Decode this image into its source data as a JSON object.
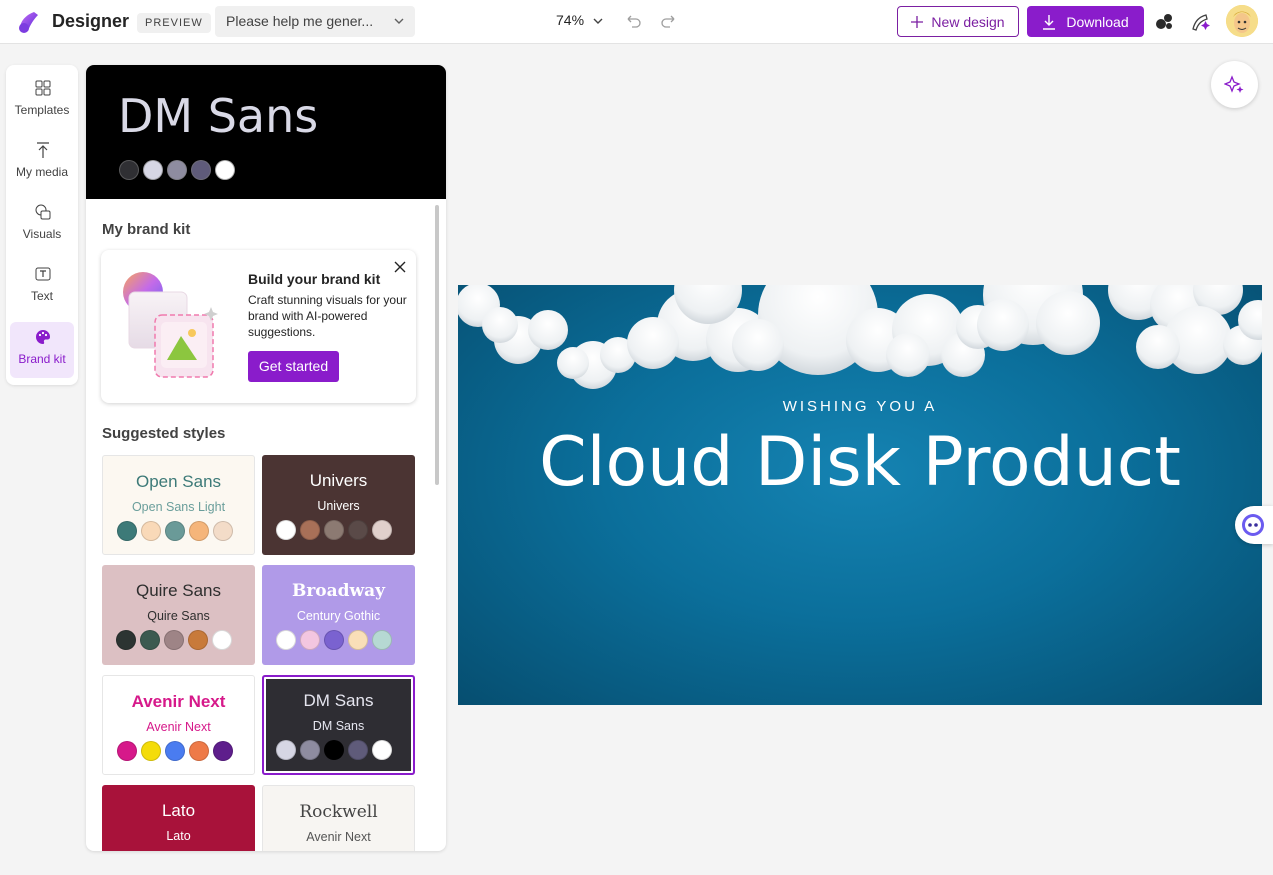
{
  "app": {
    "name": "Designer",
    "preview_badge": "PREVIEW",
    "prompt_value": "Please help me gener...",
    "zoom": "74%",
    "new_design_label": "New design",
    "download_label": "Download"
  },
  "rail": {
    "items": [
      {
        "label": "Templates",
        "icon": "templates-icon"
      },
      {
        "label": "My media",
        "icon": "upload-icon"
      },
      {
        "label": "Visuals",
        "icon": "visuals-icon"
      },
      {
        "label": "Text",
        "icon": "text-icon"
      },
      {
        "label": "Brand kit",
        "icon": "palette-icon",
        "active": true
      }
    ]
  },
  "panel": {
    "hero_title": "DM Sans",
    "hero_swatches": [
      "#2f2f33",
      "#d6d6e4",
      "#8e8ca0",
      "#5f5b7a",
      "#ffffff"
    ],
    "brand_kit_title": "My brand kit",
    "promo": {
      "title": "Build your brand kit",
      "text": "Craft stunning visuals for your brand with AI-powered suggestions.",
      "button": "Get started"
    },
    "suggested_title": "Suggested styles",
    "styles": [
      {
        "heading": "Open Sans",
        "sub": "Open Sans Light",
        "bg": "#fcf8f1",
        "fg": "#3d7a78",
        "sub_fg": "#6a9e9b",
        "colors": [
          "#3d7a78",
          "#f9d9b8",
          "#6a9a98",
          "#f5b57a",
          "#f3dcc8"
        ]
      },
      {
        "heading": "Univers",
        "sub": "Univers",
        "bg": "#4b3433",
        "fg": "#ffffff",
        "sub_fg": "#ffffff",
        "colors": [
          "#ffffff",
          "#a87058",
          "#8c7a72",
          "#5a4a48",
          "#e0d0cc"
        ]
      },
      {
        "heading": "Quire Sans",
        "sub": "Quire Sans",
        "bg": "#dcc0c3",
        "fg": "#2e2e2e",
        "sub_fg": "#2e2e2e",
        "colors": [
          "#2c3432",
          "#3b5a50",
          "#9e8486",
          "#c87a3a",
          "#ffffff"
        ]
      },
      {
        "heading": "Broadway",
        "sub": "Century Gothic",
        "bg": "#b09ae8",
        "fg": "#ffffff",
        "sub_fg": "#ffffff",
        "colors": [
          "#ffffff",
          "#f3c6e0",
          "#7a62d0",
          "#f9dfb8",
          "#b6d9d3"
        ]
      },
      {
        "heading": "Avenir Next",
        "sub": "Avenir Next",
        "bg": "#ffffff",
        "fg": "#d6198a",
        "sub_fg": "#d6198a",
        "colors": [
          "#d6198a",
          "#f4dc0a",
          "#4a7cf0",
          "#ee7a48",
          "#5e1e8c"
        ]
      },
      {
        "heading": "DM Sans",
        "sub": "DM Sans",
        "bg": "#2e2d33",
        "fg": "#e6e6f0",
        "sub_fg": "#e6e6f0",
        "colors": [
          "#d6d6e4",
          "#8e8ca0",
          "#000000",
          "#5f5b7a",
          "#ffffff"
        ],
        "selected": true
      },
      {
        "heading": "Lato",
        "sub": "Lato",
        "bg": "#a8123a",
        "fg": "#ffffff",
        "sub_fg": "#ffffff",
        "colors": []
      },
      {
        "heading": "Rockwell",
        "sub": "Avenir Next",
        "bg": "#f7f5f2",
        "fg": "#444444",
        "sub_fg": "#555555",
        "colors": []
      }
    ]
  },
  "design": {
    "subtitle": "WISHING YOU A",
    "title": "Cloud Disk Product"
  },
  "colors": {
    "accent": "#8a1ccb",
    "canvas_blue": "#0b6f9b"
  }
}
